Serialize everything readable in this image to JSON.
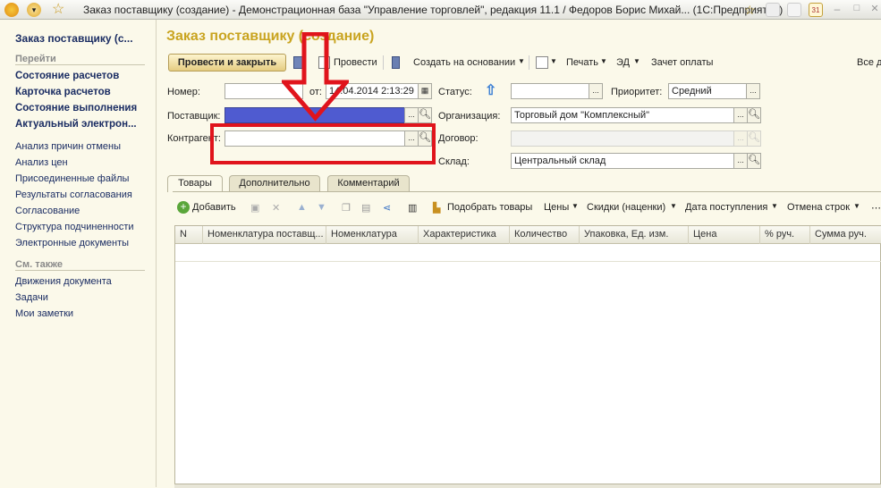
{
  "titlebar": {
    "text": "Заказ поставщику (создание) - Демонстрационная база \"Управление торговлей\", редакция 11.1 / Федоров Борис Михай...  (1С:Предприятие)",
    "icons": [
      "1c-logo-icon",
      "dropdown-icon",
      "star-icon",
      "favorite-icon",
      "save-icon",
      "print-icon",
      "calendar-icon",
      "minimize-icon",
      "maximize-icon",
      "close-icon"
    ],
    "calendar_day": "31"
  },
  "sidebar": {
    "header": "Заказ поставщику (с...",
    "section_go": "Перейти",
    "bold_links": [
      "Состояние расчетов",
      "Карточка расчетов",
      "Состояние выполнения",
      "Актуальный электрон..."
    ],
    "links": [
      "Анализ причин отмены",
      "Анализ цен",
      "Присоединенные файлы",
      "Результаты согласования",
      "Согласование",
      "Структура подчиненности",
      "Электронные документы"
    ],
    "section_see": "См. также",
    "see_links": [
      "Движения документа",
      "Задачи",
      "Мои заметки"
    ]
  },
  "page": {
    "title": "Заказ поставщику (создание)"
  },
  "toolbar": {
    "post_close": "Провести и закрыть",
    "post": "Провести",
    "create_based": "Создать на основании",
    "print": "Печать",
    "ed": "ЭД",
    "payment": "Зачет оплаты",
    "all_actions": "Все д"
  },
  "form": {
    "number_label": "Номер:",
    "number_value": "",
    "date_label": "от:",
    "date_value": "14.04.2014  2:13:29",
    "status_label": "Статус:",
    "status_value": "",
    "priority_label": "Приоритет:",
    "priority_value": "Средний",
    "supplier_label": "Поставщик:",
    "supplier_value": "",
    "org_label": "Организация:",
    "org_value": "Торговый дом \"Комплексный\"",
    "counterparty_label": "Контрагент:",
    "counterparty_value": "",
    "contract_label": "Договор:",
    "contract_value": "",
    "warehouse_label": "Склад:",
    "warehouse_value": "Центральный склад"
  },
  "tabs": [
    "Товары",
    "Дополнительно",
    "Комментарий"
  ],
  "goods_toolbar": {
    "add": "Добавить",
    "pick": "Подобрать товары",
    "prices": "Цены",
    "discounts": "Скидки (наценки)",
    "arrival": "Дата поступления",
    "cancel_rows": "Отмена строк"
  },
  "grid": {
    "columns": [
      "N",
      "Номенклатура поставщ...",
      "Номенклатура",
      "Характеристика",
      "Количество",
      "Упаковка, Ед. изм.",
      "Цена",
      "% руч.",
      "Сумма руч."
    ]
  },
  "colors": {
    "accent": "#c9a420",
    "annotation": "#e0141c",
    "supplier_fill": "#4f5bd0"
  }
}
